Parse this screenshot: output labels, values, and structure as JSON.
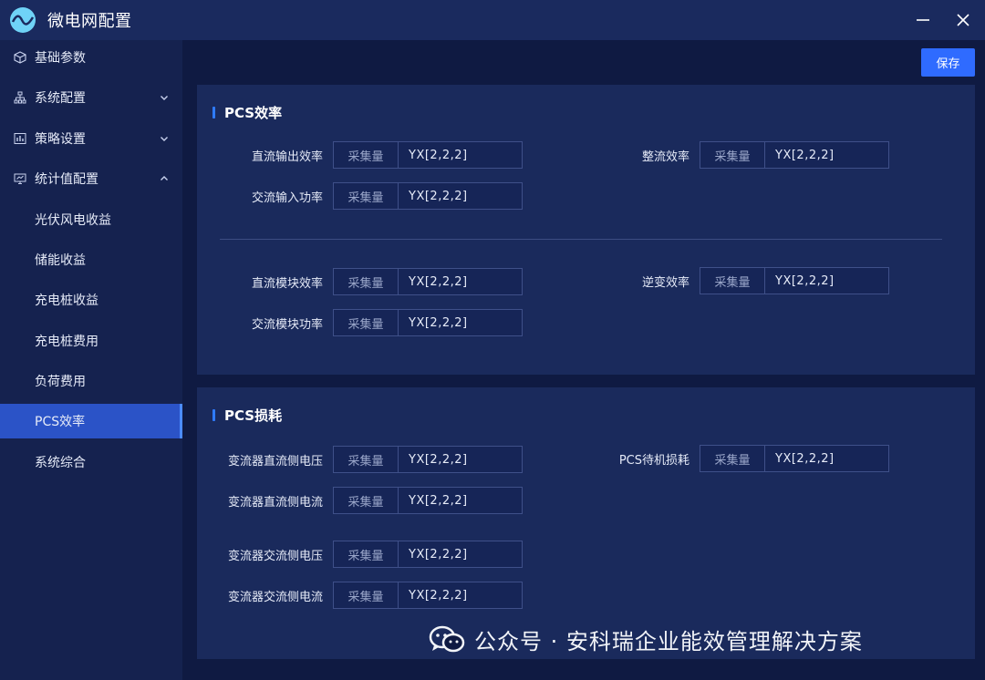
{
  "app": {
    "title": "微电网配置",
    "save_label": "保存"
  },
  "icons": {
    "accent": "#2f6bff",
    "active_nav": "#2b53c7"
  },
  "sidebar": {
    "items": [
      {
        "label": "基础参数",
        "icon": "cube-icon"
      },
      {
        "label": "系统配置",
        "icon": "network-icon",
        "chevron": "down"
      },
      {
        "label": "策略设置",
        "icon": "strategy-icon",
        "chevron": "down"
      },
      {
        "label": "统计值配置",
        "icon": "monitor-icon",
        "chevron": "up"
      },
      {
        "label": "光伏风电收益"
      },
      {
        "label": "储能收益"
      },
      {
        "label": "充电桩收益"
      },
      {
        "label": "充电桩费用"
      },
      {
        "label": "负荷费用"
      },
      {
        "label": "PCS效率",
        "active": true
      },
      {
        "label": "系统综合"
      }
    ]
  },
  "panels": [
    {
      "title": "PCS效率",
      "fields": [
        {
          "label": "直流输出效率",
          "tag": "采集量",
          "value": "YX[2,2,2]"
        },
        {
          "label": "整流效率",
          "tag": "采集量",
          "value": "YX[2,2,2]"
        },
        {
          "label": "交流输入功率",
          "tag": "采集量",
          "value": "YX[2,2,2]"
        },
        {
          "label": "直流模块效率",
          "tag": "采集量",
          "value": "YX[2,2,2]"
        },
        {
          "label": "逆变效率",
          "tag": "采集量",
          "value": "YX[2,2,2]"
        },
        {
          "label": "交流模块功率",
          "tag": "采集量",
          "value": "YX[2,2,2]"
        }
      ]
    },
    {
      "title": "PCS损耗",
      "fields": [
        {
          "label": "变流器直流侧电压",
          "tag": "采集量",
          "value": "YX[2,2,2]"
        },
        {
          "label": "PCS待机损耗",
          "tag": "采集量",
          "value": "YX[2,2,2]"
        },
        {
          "label": "变流器直流侧电流",
          "tag": "采集量",
          "value": "YX[2,2,2]"
        },
        {
          "label": "变流器交流侧电压",
          "tag": "采集量",
          "value": "YX[2,2,2]"
        },
        {
          "label": "变流器交流侧电流",
          "tag": "采集量",
          "value": "YX[2,2,2]"
        }
      ]
    }
  ],
  "watermark": {
    "text": "公众号 · 安科瑞企业能效管理解决方案",
    "icon": "wechat-icon"
  }
}
